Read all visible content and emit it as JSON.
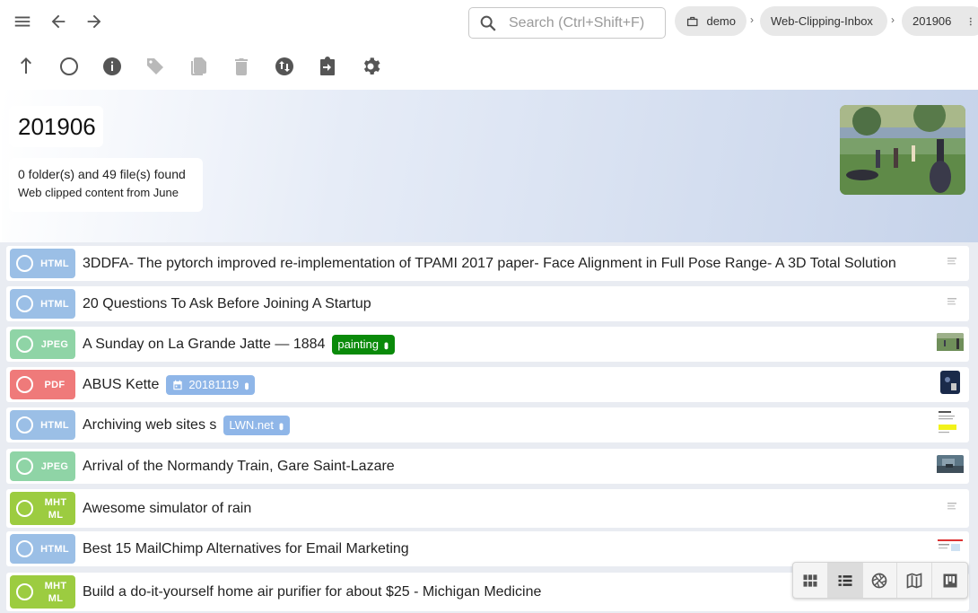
{
  "search": {
    "placeholder": "Search (Ctrl+Shift+F)",
    "value": ""
  },
  "breadcrumbs": [
    {
      "label": "demo",
      "icon": "briefcase-icon"
    },
    {
      "label": "Web-Clipping-Inbox"
    },
    {
      "label": "201906"
    }
  ],
  "toolbar": [
    "parent-directory-icon",
    "select-all-icon",
    "info-icon",
    "tag-icon",
    "copy-icon",
    "delete-icon",
    "sort-icon",
    "import-icon",
    "settings-icon"
  ],
  "directory": {
    "title": "201906",
    "count": "0 folder(s) and 49 file(s) found",
    "description": "Web clipped content from June"
  },
  "colors": {
    "html": "#9bbfe6",
    "jpeg": "#8fd4a6",
    "pdf": "#ef7a7a",
    "mhtml": "#9ccc40",
    "tag_green": "#0a8a0a",
    "tag_blue": "#8fb6e8"
  },
  "files": [
    {
      "ext": "HTML",
      "type": "html",
      "name": "3DDFA- The pytorch improved re-implementation of TPAMI 2017 paper- Face Alignment in Full Pose Range- A 3D Total Solution",
      "tags": [],
      "thumb": "doc"
    },
    {
      "ext": "HTML",
      "type": "html",
      "name": "20 Questions To Ask Before Joining A Startup",
      "tags": [],
      "thumb": "doc"
    },
    {
      "ext": "JPEG",
      "type": "jpeg",
      "name": "A Sunday on La Grande Jatte — 1884",
      "tags": [
        {
          "label": "painting",
          "color": "green"
        }
      ],
      "thumb": "painting"
    },
    {
      "ext": "PDF",
      "type": "pdf",
      "name": "ABUS Kette",
      "tags": [
        {
          "label": "20181119",
          "color": "blue",
          "date": true
        }
      ],
      "thumb": "product"
    },
    {
      "ext": "HTML",
      "type": "html",
      "name": "Archiving web sites s",
      "tags": [
        {
          "label": "LWN.net",
          "color": "blue"
        }
      ],
      "thumb": "yellow-doc"
    },
    {
      "ext": "JPEG",
      "type": "jpeg",
      "name": "Arrival of the Normandy Train, Gare Saint-Lazare",
      "tags": [],
      "thumb": "train"
    },
    {
      "ext": "MHTML",
      "type": "mhtml",
      "name": "Awesome simulator of rain",
      "tags": [],
      "thumb": "doc"
    },
    {
      "ext": "HTML",
      "type": "html",
      "name": "Best 15 MailChimp Alternatives for Email Marketing",
      "tags": [],
      "thumb": "web"
    },
    {
      "ext": "MHTML",
      "type": "mhtml",
      "name": "Build a do-it-yourself home air purifier for about $25 - Michigan Medicine",
      "tags": [],
      "thumb": "none"
    }
  ],
  "perspectives": [
    "grid-icon",
    "list-icon",
    "gallery-icon",
    "map-icon",
    "kanban-icon"
  ],
  "active_perspective": "list-icon"
}
